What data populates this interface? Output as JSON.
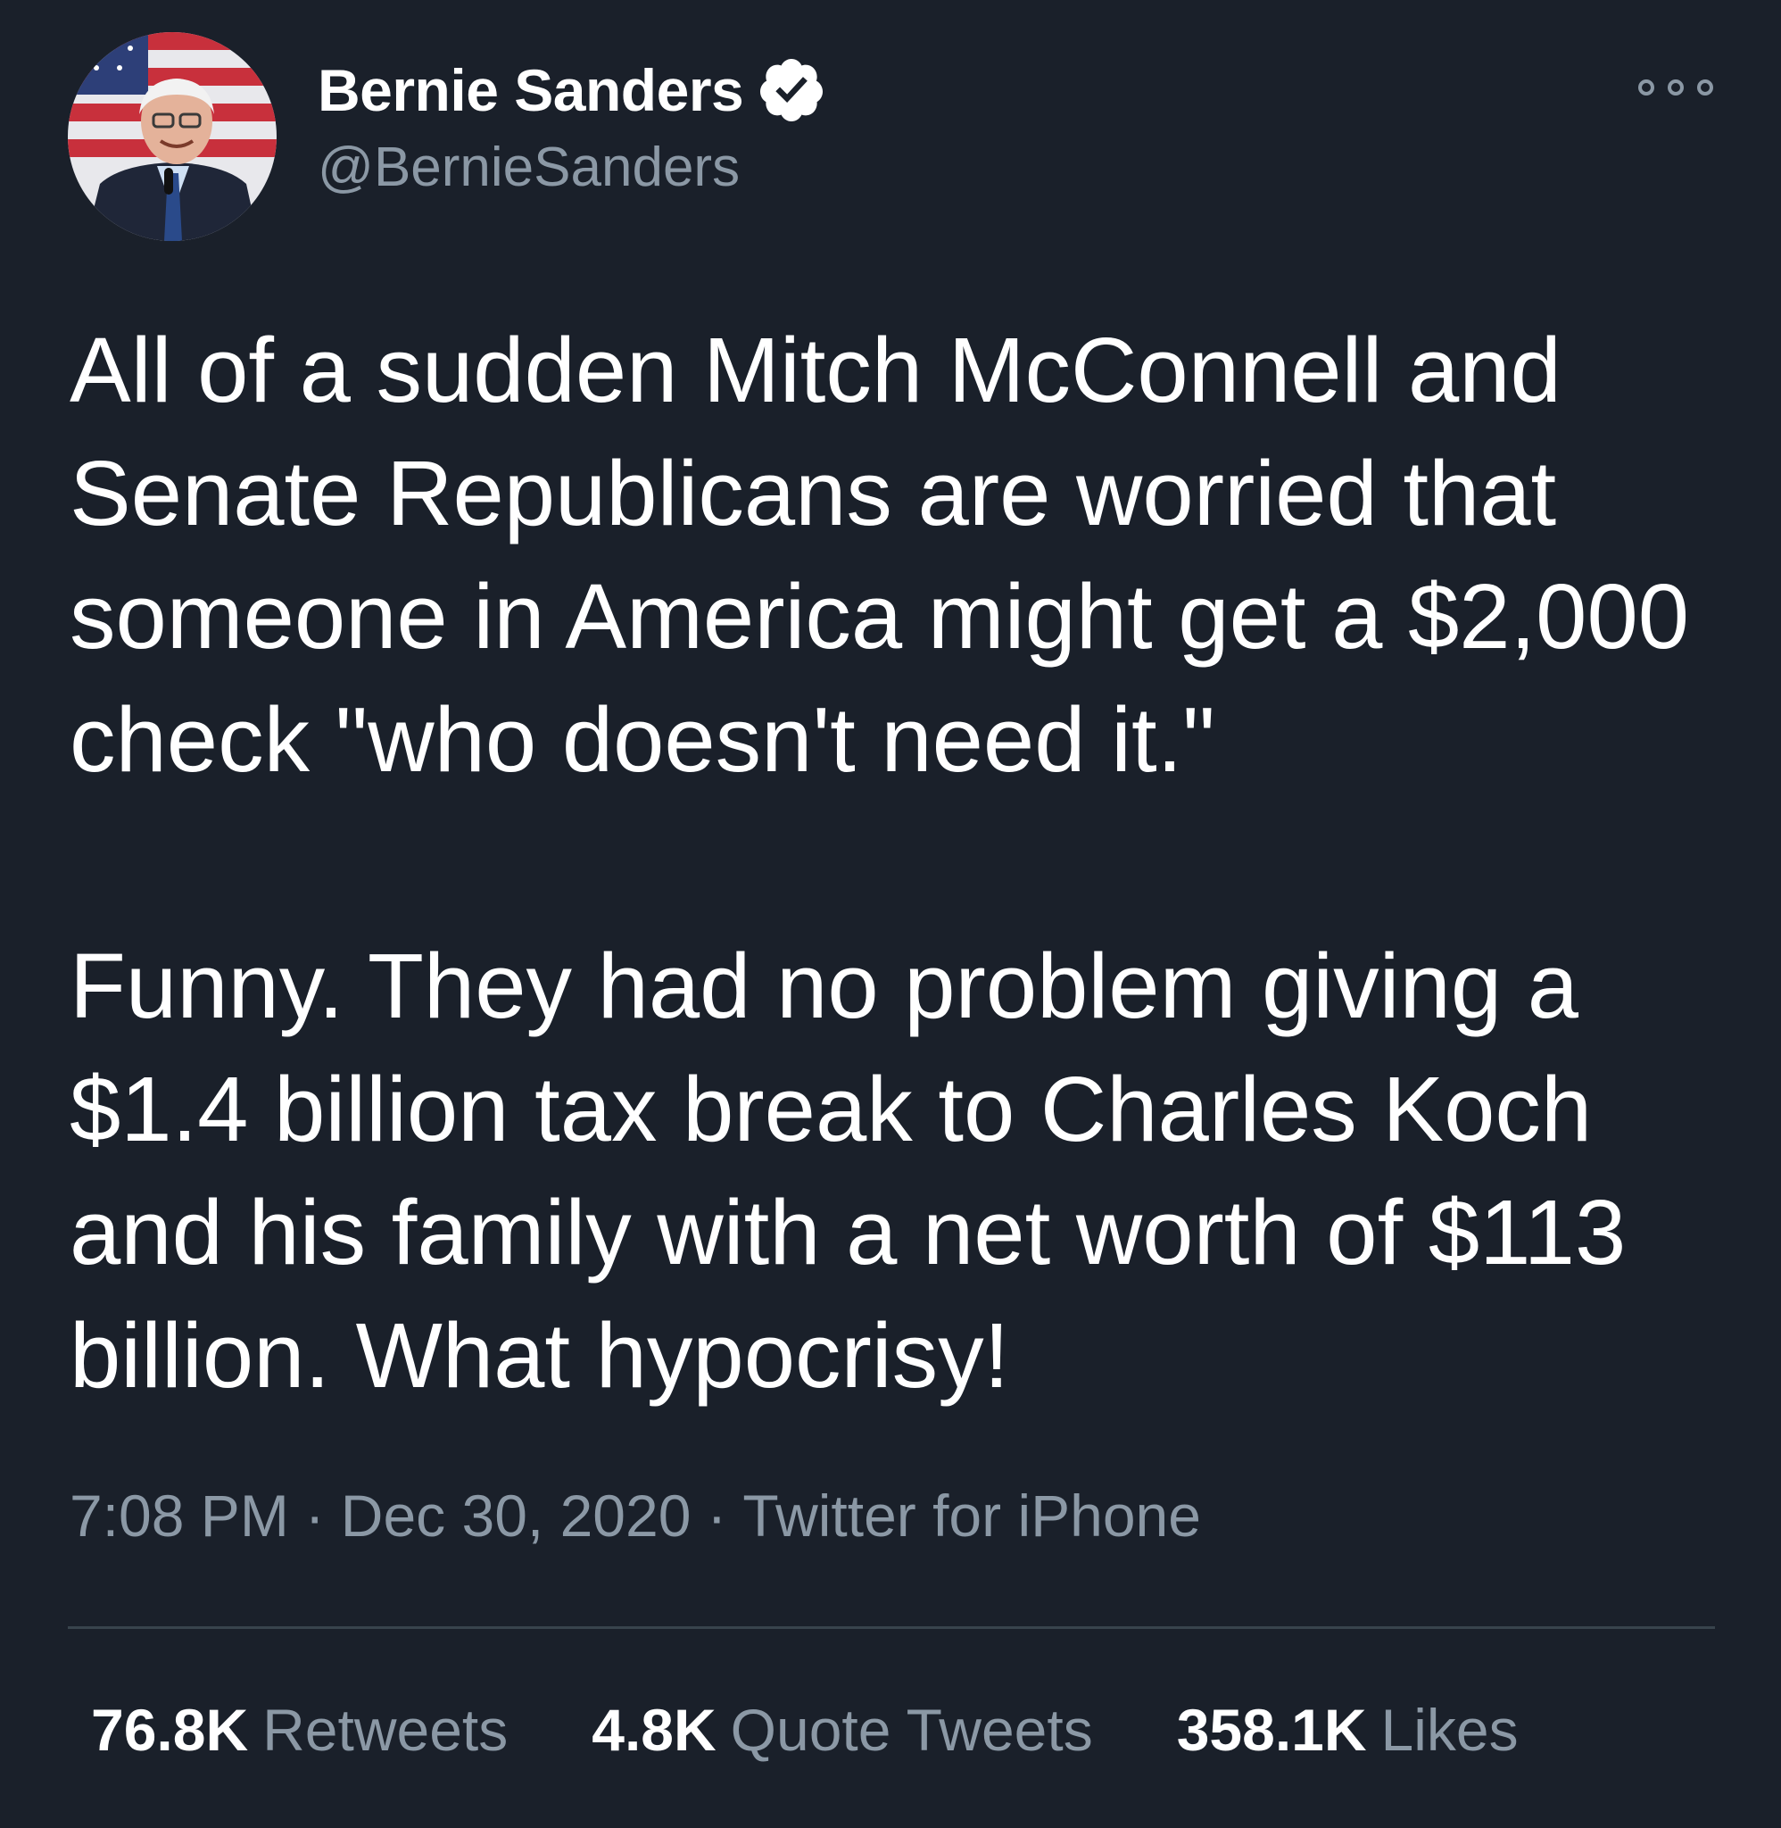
{
  "author": {
    "display_name": "Bernie Sanders",
    "handle": "@BernieSanders",
    "verified": true
  },
  "tweet": {
    "text": "All of a sudden Mitch McConnell and Senate Republicans are worried that someone in America might get a $2,000 check \"who doesn't need it.\"\n\nFunny. They had no problem giving a $1.4 billion tax break to Charles Koch and his family with a net worth of $113 billion. What hypocrisy!"
  },
  "meta": {
    "time": "7:08 PM",
    "separator": "·",
    "date": "Dec 30, 2020",
    "source": "Twitter for iPhone"
  },
  "stats": {
    "retweets_count": "76.8K",
    "retweets_label": "Retweets",
    "quotes_count": "4.8K",
    "quotes_label": "Quote Tweets",
    "likes_count": "358.1K",
    "likes_label": "Likes"
  },
  "icons": {
    "verified": "verified-badge-icon",
    "more": "more-options-icon"
  },
  "colors": {
    "background": "#1a202a",
    "text_primary": "#ffffff",
    "text_secondary": "#8b98a5",
    "divider": "#38444d"
  }
}
